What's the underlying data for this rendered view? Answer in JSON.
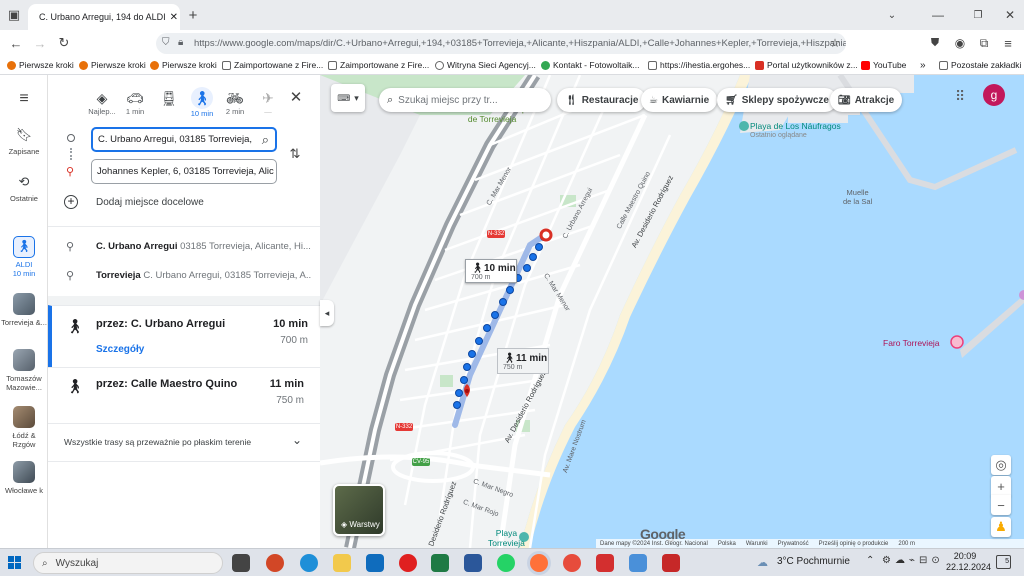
{
  "browser": {
    "tab_title": "C. Urbano Arregui, 194 do ALDI",
    "url": "https://www.google.com/maps/dir/C.+Urbano+Arregui,+194,+03185+Torrevieja,+Alicante,+Hiszpania/ALDI,+Calle+Johannes+Kepler,+Torrevieja,+Hiszpania",
    "bookmarks": [
      "Pierwsze kroki",
      "Pierwsze kroki",
      "Pierwsze kroki",
      "Zaimportowane z Fire...",
      "Zaimportowane z Fire...",
      "Witryna Sieci Agencyj...",
      "Kontakt - Fotowoltaik...",
      "https://ihestia.ergohes...",
      "Portal użytkowników z...",
      "YouTube"
    ],
    "other_bookmarks": "Pozostałe zakładki",
    "profile_letter": "g"
  },
  "rail": {
    "saved": "Zapisane",
    "recent": "Ostatnie",
    "aldi_label": "ALDI",
    "aldi_time": "10 min",
    "recents": [
      "Torrevieja &...",
      "Tomaszów Mazowie...",
      "Łódź & Rzgów",
      "Włocławe k"
    ]
  },
  "modes": [
    {
      "label": "Najlep...",
      "icon": "best-route-icon"
    },
    {
      "label": "1 min",
      "icon": "car-icon"
    },
    {
      "label": "",
      "icon": "transit-icon"
    },
    {
      "label": "10 min",
      "icon": "walk-icon"
    },
    {
      "label": "2 min",
      "icon": "bike-icon"
    },
    {
      "label": "—",
      "icon": "flight-icon"
    }
  ],
  "inputs": {
    "origin": "C. Urbano Arregui, 03185 Torrevieja,",
    "destination": "Johannes Kepler, 6, 03185 Torrevieja, Alic",
    "add_destination": "Dodaj miejsce docelowe"
  },
  "suggestions": [
    {
      "name": "C. Urbano Arregui",
      "rest": " 03185 Torrevieja, Alicante, Hi..."
    },
    {
      "name": "Torrevieja",
      "rest": " C. Urbano Arregui, 03185 Torrevieja, A..."
    }
  ],
  "routes": [
    {
      "via": "przez: C. Urbano Arregui",
      "time": "10 min",
      "dist": "700 m",
      "details": "Szczegóły"
    },
    {
      "via": "przez: Calle Maestro Quino",
      "time": "11 min",
      "dist": "750 m"
    }
  ],
  "terrain_note": "Wszystkie trasy są przeważnie po płaskim terenie",
  "map": {
    "search_placeholder": "Szukaj miejsc przy tr...",
    "chips": [
      "Restauracje",
      "Kawiarnie",
      "Sklepy spożywcze",
      "Atrakcje"
    ],
    "labels": {
      "cemetery": [
        "Cementerio Municipal",
        "de Torrevieja"
      ],
      "beach_name": [
        "Playa de Los Náufragos",
        "Ostatnio oglądane"
      ],
      "pier": [
        "Muelle",
        "de la Sal"
      ],
      "lighthouse": "Faro Torrevieja",
      "playa": [
        "Playa",
        "Torrevieja"
      ],
      "streets": [
        "C. Mar Menor",
        "C. Urbano Arregui",
        "Calle Maestro Quino",
        "Av. Desiderio Rodríguez",
        "C. Mar Menor",
        "Av. Desiderio Rodríguez",
        "Av. Mare Nostrum",
        "C. Mar Negro",
        "C. Mar Rojo",
        "Av. Desiderio Rodríguez"
      ],
      "roads": [
        "N-332",
        "N-332",
        "CV-95"
      ]
    },
    "bubble1": {
      "time": "10 min",
      "dist": "700 m"
    },
    "bubble2": {
      "time": "11 min",
      "dist": "750 m"
    },
    "layers": "Warstwy",
    "footer": [
      "Dane mapy ©2024 Inst. Geogr. Nacional",
      "Polska",
      "Warunki",
      "Prywatność",
      "Prześlij opinię o produkcie",
      "200 m"
    ],
    "google": "Google"
  },
  "taskbar": {
    "search": "Wyszukaj",
    "weather": "3°C  Pochmurnie",
    "time": "20:09",
    "date": "22.12.2024",
    "notif_count": "5"
  },
  "colors": {
    "route": "#1a73e8",
    "alt_route": "#9fb9e8",
    "water": "#aadaff",
    "land": "#f1f3f4",
    "accent": "#1a73e8"
  }
}
